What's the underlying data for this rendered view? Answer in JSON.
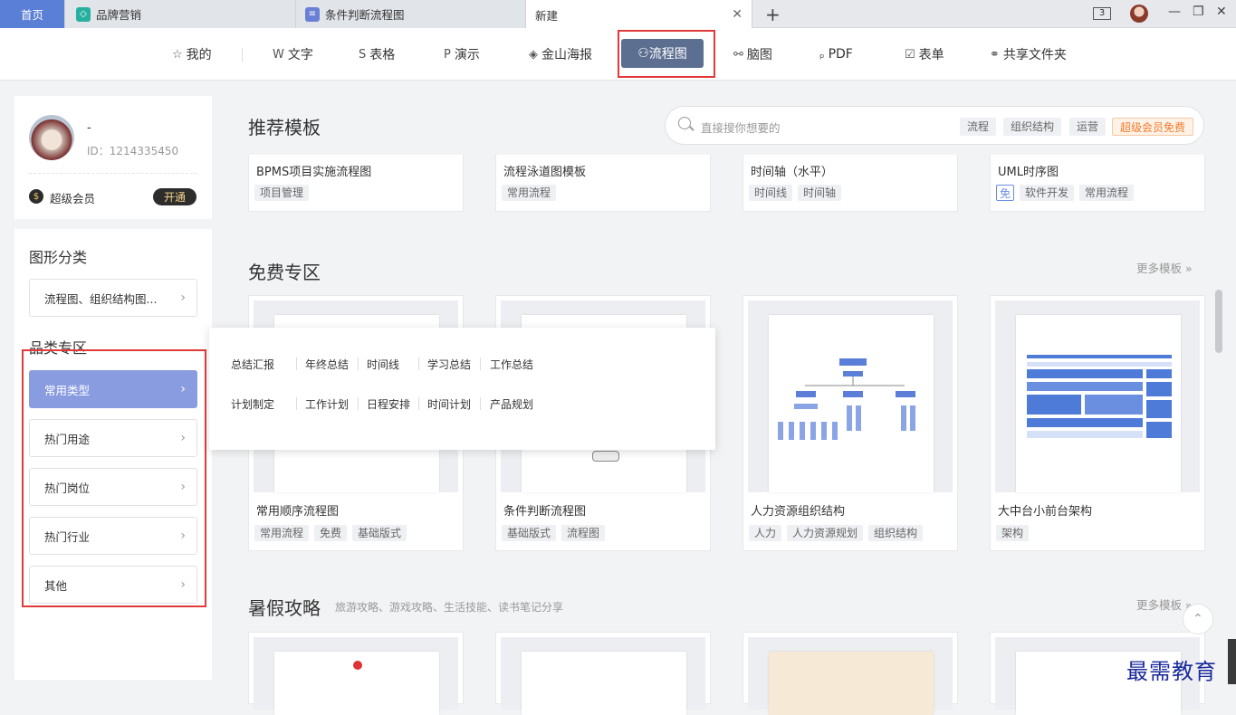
{
  "tabs": {
    "home": "首页",
    "tab1": "品牌营销",
    "tab2": "条件判断流程图",
    "tab3": "新建",
    "tab_count": "3"
  },
  "nav": {
    "items": [
      "我的",
      "文字",
      "表格",
      "演示",
      "金山海报",
      "流程图",
      "脑图",
      "PDF",
      "表单",
      "共享文件夹"
    ],
    "active": "流程图"
  },
  "user": {
    "name": "-",
    "id": "ID：1214335450",
    "vip_label": "超级会员",
    "open_btn": "开通"
  },
  "sidebar": {
    "shape_title": "图形分类",
    "shape_select": "流程图、组织结构图...",
    "category_title": "品类专区",
    "categories": [
      "常用类型",
      "热门用途",
      "热门岗位",
      "热门行业",
      "其他"
    ]
  },
  "recommend": {
    "title": "推荐模板",
    "search_placeholder": "直接搜你想要的",
    "search_tags": [
      "流程",
      "组织结构",
      "运营",
      "超级会员免费"
    ],
    "cards": [
      {
        "title": "BPMS项目实施流程图",
        "tags": [
          "项目管理"
        ]
      },
      {
        "title": "流程泳道图模板",
        "tags": [
          "常用流程"
        ]
      },
      {
        "title": "时间轴（水平）",
        "tags": [
          "时间线",
          "时间轴"
        ]
      },
      {
        "title": "UML时序图",
        "tags": [
          "免",
          "软件开发",
          "常用流程"
        ]
      }
    ]
  },
  "free": {
    "title": "免费专区",
    "more": "更多模板 »",
    "cards": [
      {
        "title": "常用顺序流程图",
        "tags": [
          "常用流程",
          "免费",
          "基础版式"
        ]
      },
      {
        "title": "条件判断流程图",
        "tags": [
          "基础版式",
          "流程图"
        ]
      },
      {
        "title": "人力资源组织结构",
        "tags": [
          "人力",
          "人力资源规划",
          "组织结构"
        ]
      },
      {
        "title": "大中台小前台架构",
        "tags": [
          "架构"
        ]
      }
    ]
  },
  "summer": {
    "title": "暑假攻略",
    "subtitle": "旅游攻略、游戏攻略、生活技能、读书笔记分享",
    "more": "更多模板 »"
  },
  "popup": {
    "row1": [
      "总结汇报",
      "年终总结",
      "时间线",
      "学习总结",
      "工作总结"
    ],
    "row2": [
      "计划制定",
      "工作计划",
      "日程安排",
      "时间计划",
      "产品规划"
    ]
  },
  "watermark": "最需教育"
}
